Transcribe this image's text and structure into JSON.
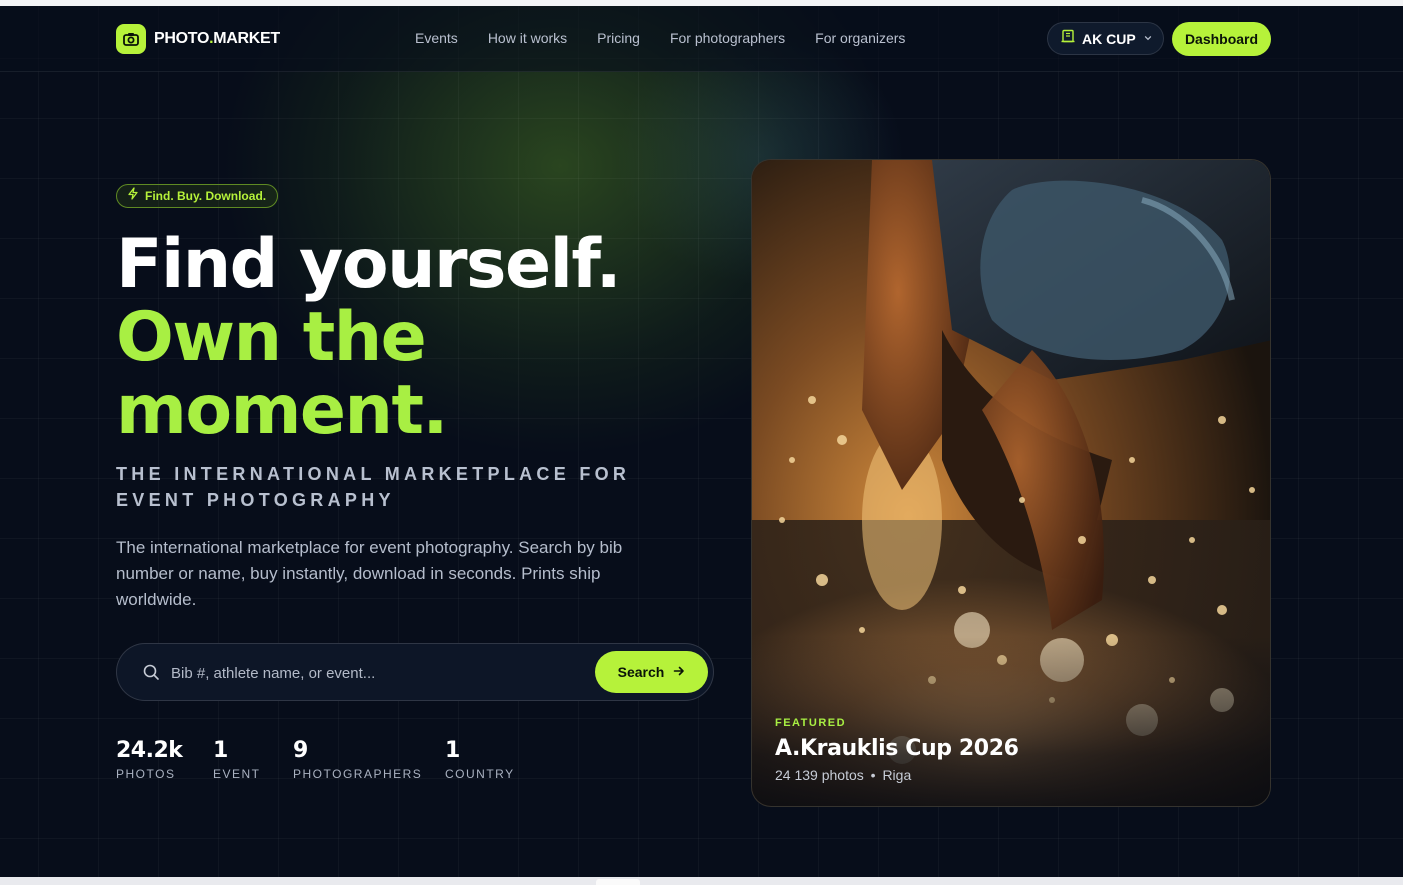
{
  "brand": {
    "name_main": "PHOTO",
    "name_dot": ".",
    "name_end": "MARKET",
    "accent": "#b6f23a",
    "icon": "camera-icon"
  },
  "nav": {
    "links": [
      "Events",
      "How it works",
      "Pricing",
      "For photographers",
      "For organizers"
    ],
    "event_selector": {
      "label": "AK CUP",
      "icon": "building-icon"
    },
    "dashboard_label": "Dashboard"
  },
  "hero": {
    "tagline": "Find. Buy. Download.",
    "headline": {
      "line1": "Find yourself.",
      "line2": "Own the",
      "line3": "moment."
    },
    "subheading": "THE INTERNATIONAL MARKETPLACE FOR EVENT PHOTOGRAPHY",
    "description": "The international marketplace for event photography. Search by bib number or name, buy instantly, download in seconds. Prints ship worldwide.",
    "search": {
      "placeholder": "Bib #, athlete name, or event...",
      "button": "Search"
    },
    "stats": [
      {
        "value": "24.2k",
        "label": "PHOTOS"
      },
      {
        "value": "1",
        "label": "EVENT"
      },
      {
        "value": "9",
        "label": "PHOTOGRAPHERS"
      },
      {
        "value": "1",
        "label": "COUNTRY"
      }
    ]
  },
  "featured": {
    "badge": "FEATURED",
    "title": "A.Krauklis Cup 2026",
    "photos": "24 139 photos",
    "separator": "•",
    "location": "Riga"
  }
}
